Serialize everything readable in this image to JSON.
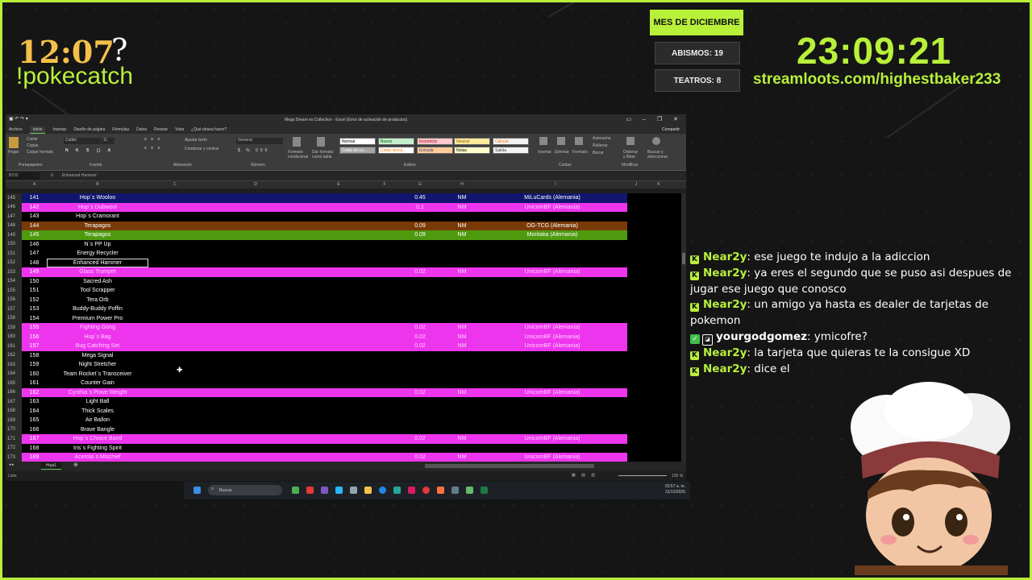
{
  "overlay": {
    "left_clock": "12:07",
    "left_clock_suffix": "?",
    "command": "!pokecatch",
    "month_label": "MES DE DICIEMBRE",
    "stat_abismos": "ABISMOS: 19",
    "stat_teatros": "TEATROS: 8",
    "right_clock": "23:09:21",
    "url": "streamloots.com/highestbaker233",
    "accent_color": "#b8f03a"
  },
  "excel": {
    "window_title": "Mega Dream ex Collection - Excel (Error de activación de productos)",
    "share_label": "Compartir",
    "tabs": [
      "Archivo",
      "Inicio",
      "Insertar",
      "Diseño de página",
      "Fórmulas",
      "Datos",
      "Revisar",
      "Vista",
      "¿Qué desea hacer?"
    ],
    "active_tab": "Inicio",
    "ribbon": {
      "paste": "Pegar",
      "cut": "Cortar",
      "copy": "Copiar",
      "format_painter": "Copiar formato",
      "clipboard": "Portapapeles",
      "font_name": "Calibri",
      "font_size": "11",
      "font_group": "Fuente",
      "wrap_text": "Ajustar texto",
      "merge_center": "Combinar y centrar",
      "alignment_group": "Alineación",
      "number_format": "General",
      "number_group": "Número",
      "conditional_format": "Formato condicional",
      "format_as_table": "Dar formato como tabla",
      "styles_group": "Estilos",
      "insert": "Insertar",
      "delete": "Eliminar",
      "format": "Formato",
      "cells_group": "Celdas",
      "autosum": "Autosuma",
      "fill": "Rellenar",
      "clear": "Borrar",
      "sort_filter": "Ordenar y filtrar",
      "find_select": "Buscar y seleccionar",
      "modify_group": "Modificar",
      "styles": [
        {
          "label": "Normal",
          "bg": "#ffffff",
          "fg": "#000000"
        },
        {
          "label": "Bueno",
          "bg": "#c6efce",
          "fg": "#006100"
        },
        {
          "label": "Incorrecto",
          "bg": "#ffc7ce",
          "fg": "#9c0006"
        },
        {
          "label": "Neutral",
          "bg": "#ffeb9c",
          "fg": "#9c5700"
        },
        {
          "label": "Cálculo",
          "bg": "#f2f2f2",
          "fg": "#fa7d00"
        },
        {
          "label": "Celda de co...",
          "bg": "#a5a5a5",
          "fg": "#ffffff"
        },
        {
          "label": "Celda vincul...",
          "bg": "#ffffff",
          "fg": "#fa7d00"
        },
        {
          "label": "Entrada",
          "bg": "#ffcc99",
          "fg": "#3f3f76"
        },
        {
          "label": "Notas",
          "bg": "#ffffcc",
          "fg": "#000000"
        },
        {
          "label": "Salida",
          "bg": "#f2f2f2",
          "fg": "#3f3f3f"
        }
      ]
    },
    "name_box": "B152",
    "fx": "fx",
    "formula_value": "Enhanced Hammer",
    "columns": [
      "A",
      "B",
      "C",
      "D",
      "E",
      "F",
      "G",
      "H",
      "I",
      "J",
      "K"
    ],
    "rows": [
      {
        "r": "145",
        "a": "141",
        "b": "Hop´s Wooloo",
        "g": "0.45",
        "h": "NM",
        "i": "MiLuCards (Alemania)",
        "fill": "#10166e"
      },
      {
        "r": "146",
        "a": "142",
        "b": "Hop´s Dubwool",
        "g": "0.1",
        "h": "NM",
        "i": "UnicornBF (Alemania)",
        "fill": "#ee35ee"
      },
      {
        "r": "147",
        "a": "143",
        "b": "Hop´s Cramorant",
        "g": "",
        "h": "",
        "i": "",
        "fill": ""
      },
      {
        "r": "148",
        "a": "144",
        "b": "Terapagos",
        "g": "0.09",
        "h": "NM",
        "i": "OG-TCG (Alemania)",
        "fill": "#7a3a08"
      },
      {
        "r": "149",
        "a": "145",
        "b": "Terapagos",
        "g": "0.09",
        "h": "NM",
        "i": "Moritaka (Alemania)",
        "fill": "#4e9a0f"
      },
      {
        "r": "150",
        "a": "146",
        "b": "N´s PP Up",
        "g": "",
        "h": "",
        "i": "",
        "fill": ""
      },
      {
        "r": "151",
        "a": "147",
        "b": "Energy Recycler",
        "g": "",
        "h": "",
        "i": "",
        "fill": ""
      },
      {
        "r": "152",
        "a": "148",
        "b": "Enhanced Hammer",
        "g": "",
        "h": "",
        "i": "",
        "fill": "",
        "selected": "true"
      },
      {
        "r": "153",
        "a": "149",
        "b": "Glass Trumpet",
        "g": "0.02",
        "h": "NM",
        "i": "UnicornBF (Alemania)",
        "fill": "#ee35ee"
      },
      {
        "r": "154",
        "a": "150",
        "b": "Sacred Ash",
        "g": "",
        "h": "",
        "i": "",
        "fill": ""
      },
      {
        "r": "155",
        "a": "151",
        "b": "Tool Scrapper",
        "g": "",
        "h": "",
        "i": "",
        "fill": ""
      },
      {
        "r": "156",
        "a": "152",
        "b": "Tera Orb",
        "g": "",
        "h": "",
        "i": "",
        "fill": ""
      },
      {
        "r": "157",
        "a": "153",
        "b": "Buddy-Buddy Poffin",
        "g": "",
        "h": "",
        "i": "",
        "fill": ""
      },
      {
        "r": "158",
        "a": "154",
        "b": "Premium Power Pro",
        "g": "",
        "h": "",
        "i": "",
        "fill": ""
      },
      {
        "r": "159",
        "a": "155",
        "b": "Fighting Gong",
        "g": "0.02",
        "h": "NM",
        "i": "UnicornBF (Alemania)",
        "fill": "#ee35ee"
      },
      {
        "r": "160",
        "a": "156",
        "b": "Hop´s Bag",
        "g": "0.02",
        "h": "NM",
        "i": "UnicornBF (Alemania)",
        "fill": "#ee35ee"
      },
      {
        "r": "161",
        "a": "157",
        "b": "Bug Catching Set",
        "g": "0.02",
        "h": "NM",
        "i": "UnicornBF (Alemania)",
        "fill": "#ee35ee"
      },
      {
        "r": "162",
        "a": "158",
        "b": "Mega Signal",
        "g": "",
        "h": "",
        "i": "",
        "fill": ""
      },
      {
        "r": "163",
        "a": "159",
        "b": "Night Stretcher",
        "g": "",
        "h": "",
        "i": "",
        "fill": ""
      },
      {
        "r": "164",
        "a": "160",
        "b": "Team Rocket´s Transceiver",
        "g": "",
        "h": "",
        "i": "",
        "fill": ""
      },
      {
        "r": "165",
        "a": "161",
        "b": "Counter Gain",
        "g": "",
        "h": "",
        "i": "",
        "fill": ""
      },
      {
        "r": "166",
        "a": "162",
        "b": "Cynthia´s Powe Weight",
        "g": "0.02",
        "h": "NM",
        "i": "UnicornBF (Alemania)",
        "fill": "#ee35ee"
      },
      {
        "r": "167",
        "a": "163",
        "b": "Light Ball",
        "g": "",
        "h": "",
        "i": "",
        "fill": ""
      },
      {
        "r": "168",
        "a": "164",
        "b": "Thick Scales",
        "g": "",
        "h": "",
        "i": "",
        "fill": ""
      },
      {
        "r": "169",
        "a": "165",
        "b": "Air Ballon",
        "g": "",
        "h": "",
        "i": "",
        "fill": ""
      },
      {
        "r": "170",
        "a": "166",
        "b": "Brave Bangle",
        "g": "",
        "h": "",
        "i": "",
        "fill": ""
      },
      {
        "r": "171",
        "a": "167",
        "b": "Hop´s Choice Band",
        "g": "0.02",
        "h": "NM",
        "i": "UnicornBF (Alemania)",
        "fill": "#ee35ee"
      },
      {
        "r": "172",
        "a": "168",
        "b": "Iris´s Fighting Spirit",
        "g": "",
        "h": "",
        "i": "",
        "fill": ""
      },
      {
        "r": "173",
        "a": "169",
        "b": "Acerola´s Mischief",
        "g": "0.02",
        "h": "NM",
        "i": "UnicornBF (Alemania)",
        "fill": "#ee35ee"
      }
    ],
    "sheet_tab": "Hoja1",
    "status_left": "Listo",
    "zoom": "130 %"
  },
  "taskbar": {
    "search_placeholder": "Buscar",
    "time": "03:57 a. m.",
    "date": "31/12/2025"
  },
  "chat": {
    "messages": [
      {
        "user": "Near2y",
        "text": ": ese juego te indujo a la adiccion",
        "badge": "k"
      },
      {
        "user": "Near2y",
        "text": ": ya eres el segundo que se puso asi despues de jugar ese juego que conosco",
        "badge": "k"
      },
      {
        "user": "Near2y",
        "text": ": un amigo ya hasta es dealer de tarjetas de pokemon",
        "badge": "k"
      },
      {
        "user": "yourgodgomez",
        "text": ": ymicofre?",
        "badge": "check"
      },
      {
        "user": "Near2y",
        "text": ": la tarjeta que quieras te la consigue XD",
        "badge": "k"
      },
      {
        "user": "Near2y",
        "text": ": dice el",
        "badge": "k"
      }
    ]
  }
}
